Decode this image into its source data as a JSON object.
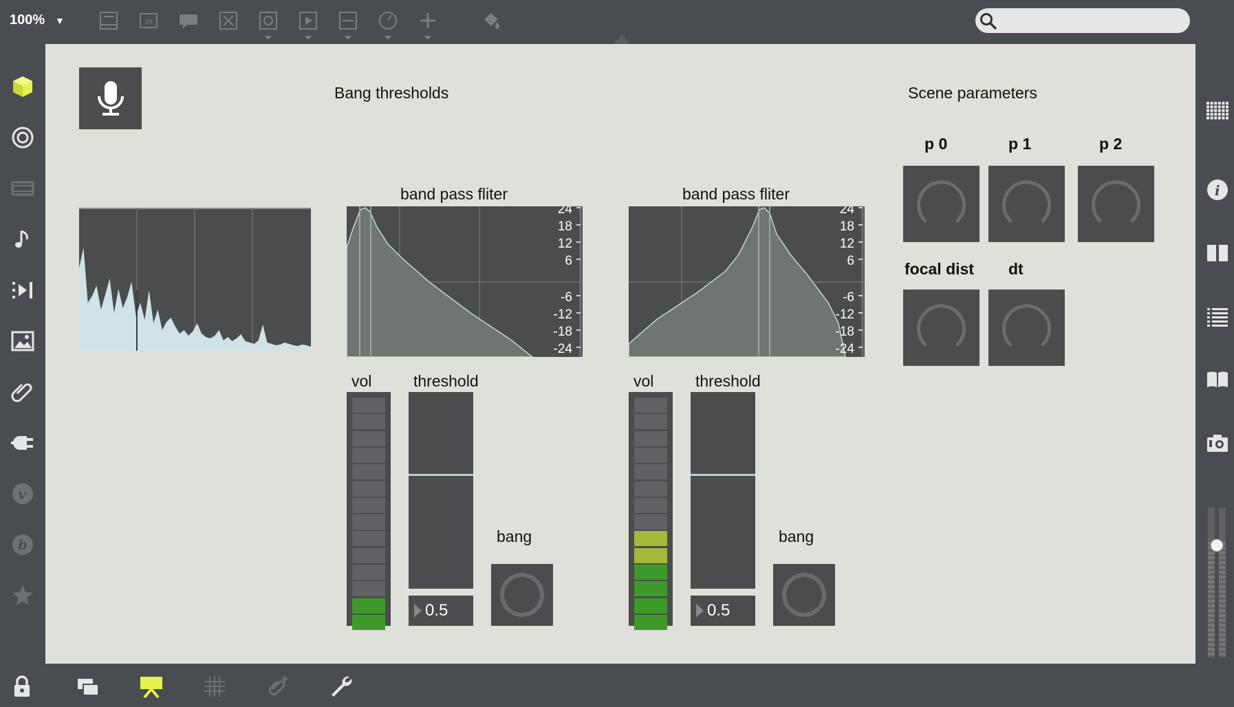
{
  "toolbar": {
    "zoom": "100%",
    "zoom_caret": "▼",
    "search_placeholder": ""
  },
  "canvas": {
    "title_bang": "Bang thresholds",
    "title_scene": "Scene parameters",
    "filters": [
      {
        "title": "band pass fliter",
        "ticks": [
          "24",
          "18",
          "12",
          "6",
          "-6",
          "-12",
          "-18",
          "-24"
        ],
        "peak": "left"
      },
      {
        "title": "band pass fliter",
        "ticks": [
          "24",
          "18",
          "12",
          "6",
          "-6",
          "-12",
          "-18",
          "-24"
        ],
        "peak": "right"
      }
    ],
    "channels": [
      {
        "vol_label": "vol",
        "threshold_label": "threshold",
        "threshold_value": "0.5",
        "bang_label": "bang",
        "meter_level_segments": 2,
        "threshold_level": 0.5
      },
      {
        "vol_label": "vol",
        "threshold_label": "threshold",
        "threshold_value": "0.5",
        "bang_label": "bang",
        "meter_level_segments": 6,
        "threshold_level": 0.5
      }
    ],
    "dials": [
      {
        "label": "p 0"
      },
      {
        "label": "p 1"
      },
      {
        "label": "p 2"
      },
      {
        "label": "focal dist"
      },
      {
        "label": "dt"
      }
    ]
  },
  "colors": {
    "canvas_bg": "#dfe0da",
    "chrome_bg": "#494c51",
    "panel_bg": "#4a4c4d",
    "accent_yellow": "#e4f24b",
    "meter_green": "#3e9a2b",
    "meter_yellowgreen": "#a4b83a",
    "spectrum_fill": "#cfe3e6",
    "power_blue": "#3aa7e6"
  },
  "icons": {
    "left_bar": [
      "cube-icon",
      "target-icon",
      "film-icon",
      "music-note-icon",
      "play-list-icon",
      "image-icon",
      "paperclip-icon",
      "plug-icon",
      "v-icon",
      "b-icon",
      "star-icon"
    ],
    "right_bar": [
      "grid-icon",
      "info-icon",
      "columns-icon",
      "list-icon",
      "book-icon",
      "camera-icon"
    ],
    "bottom_bar": [
      "lock-icon",
      "windows-icon",
      "presentation-icon",
      "grid-icon",
      "paperclip-add-icon",
      "wrench-icon"
    ]
  }
}
